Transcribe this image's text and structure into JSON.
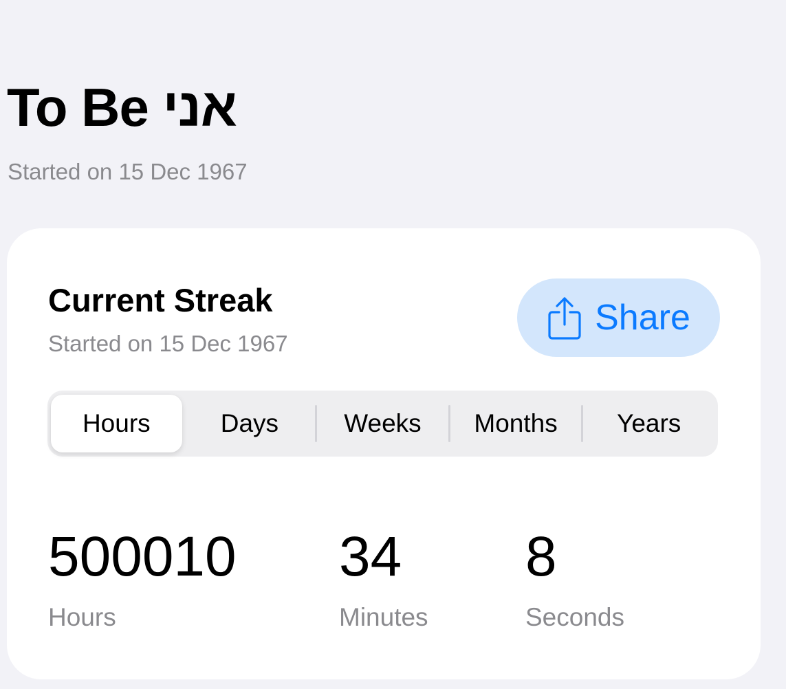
{
  "header": {
    "title": "To Be אני",
    "subtitle": "Started on 15 Dec 1967"
  },
  "streak_card": {
    "title": "Current Streak",
    "subtitle": "Started on 15 Dec 1967",
    "share_label": "Share",
    "share_icon": "share-icon",
    "segments": [
      {
        "label": "Hours",
        "selected": true
      },
      {
        "label": "Days",
        "selected": false
      },
      {
        "label": "Weeks",
        "selected": false
      },
      {
        "label": "Months",
        "selected": false
      },
      {
        "label": "Years",
        "selected": false
      }
    ],
    "stats": [
      {
        "value": "500010",
        "label": "Hours"
      },
      {
        "value": "34",
        "label": "Minutes"
      },
      {
        "value": "8",
        "label": "Seconds"
      }
    ]
  },
  "colors": {
    "background": "#f2f2f7",
    "card": "#ffffff",
    "accent": "#0a7aff",
    "share_button_bg": "#d3e6fc",
    "secondary_text": "#8a8a8e"
  }
}
